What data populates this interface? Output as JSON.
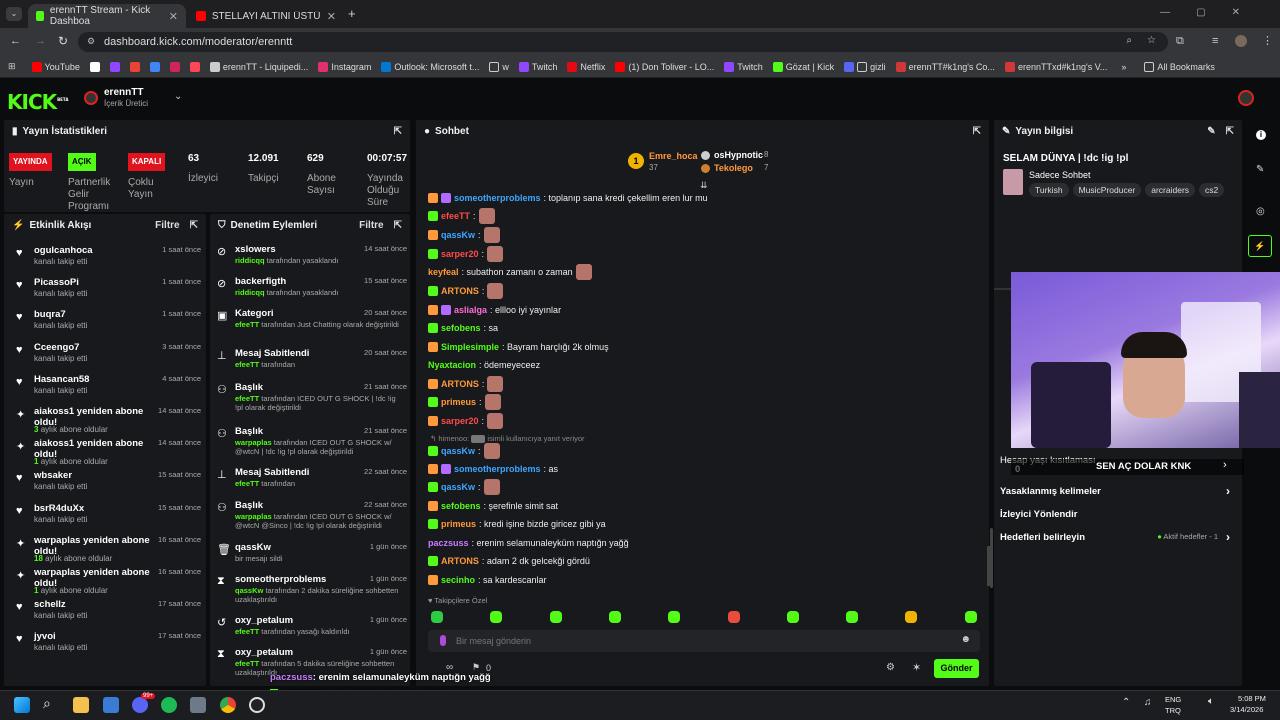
{
  "browser": {
    "tabs": [
      {
        "label": "erennTT Stream - Kick Dashboa"
      },
      {
        "label": "STELLAYI ALTINI ÜSTÜNE GETİR"
      }
    ],
    "url": "dashboard.kick.com/moderator/erenntt",
    "bookmarks": [
      "YouTube",
      "erennTT - Liquipedi...",
      "Instagram",
      "Outlook: Microsoft t...",
      "w",
      "Twitch",
      "Netflix",
      "(1) Don Toliver - LO...",
      "Twitch",
      "Gözat | Kick",
      "gizli",
      "erennTT#k1ng's Co...",
      "erennTTxd#k1ng's V..."
    ],
    "all_bookmarks": "All Bookmarks"
  },
  "header": {
    "logo": "KICK",
    "beta": "BETA",
    "user": "erennTT",
    "role": "İçerik Üretici"
  },
  "stats": {
    "title": "Yayın İstatistikleri",
    "yayin_badge": "YAYINDA",
    "yayin_label": "Yayın",
    "acik_badge": "AÇIK",
    "partner_label": "Partnerlik Gelir Programı",
    "kapali_badge": "KAPALI",
    "coklu_label": "Çoklu Yayın",
    "izleyici_val": "63",
    "izleyici_label": "İzleyici",
    "takipci_val": "12.091",
    "takipci_label": "Takipçi",
    "abone_val": "629",
    "abone_label": "Abone Sayısı",
    "sure_val": "00:07:57",
    "sure_label": "Yayında Olduğu Süre"
  },
  "activity": {
    "title": "Etkinlik Akışı",
    "filter": "Filtre",
    "items": [
      {
        "name": "ogulcanhoca",
        "sub": "kanalı takip etti",
        "time": "1 saat önce",
        "icon": "heart"
      },
      {
        "name": "PicassoPi",
        "sub": "kanalı takip etti",
        "time": "1 saat önce",
        "icon": "heart"
      },
      {
        "name": "buqra7",
        "sub": "kanalı takip etti",
        "time": "1 saat önce",
        "icon": "heart"
      },
      {
        "name": "Cceengo7",
        "sub": "kanalı takip etti",
        "time": "3 saat önce",
        "icon": "heart"
      },
      {
        "name": "Hasancan58",
        "sub": "kanalı takip etti",
        "time": "4 saat önce",
        "icon": "heart"
      },
      {
        "name": "aiakoss1 yeniden abone oldu!",
        "num": "3",
        "sub": "aylık abone oldular",
        "time": "14 saat önce",
        "icon": "star"
      },
      {
        "name": "aiakoss1 yeniden abone oldu!",
        "num": "1",
        "sub": "aylık abone oldular",
        "time": "14 saat önce",
        "icon": "star"
      },
      {
        "name": "wbsaker",
        "sub": "kanalı takip etti",
        "time": "15 saat önce",
        "icon": "heart"
      },
      {
        "name": "bsrR4duXx",
        "sub": "kanalı takip etti",
        "time": "15 saat önce",
        "icon": "heart"
      },
      {
        "name": "warpaplas yeniden abone oldu!",
        "num": "18",
        "sub": "aylık abone oldular",
        "time": "16 saat önce",
        "icon": "star"
      },
      {
        "name": "warpaplas yeniden abone oldu!",
        "num": "1",
        "sub": "aylık abone oldular",
        "time": "16 saat önce",
        "icon": "star"
      },
      {
        "name": "schellz",
        "sub": "kanalı takip etti",
        "time": "17 saat önce",
        "icon": "heart"
      },
      {
        "name": "jyvoi",
        "sub": "kanalı takip etti",
        "time": "17 saat önce",
        "icon": "heart"
      }
    ]
  },
  "moderation": {
    "title": "Denetim Eylemleri",
    "filter": "Filtre",
    "items": [
      {
        "name": "xslowers",
        "time": "14 saat önce",
        "actor": "riddicqq",
        "desc": " tarafından yasaklandı"
      },
      {
        "name": "backerfigth",
        "time": "15 saat önce",
        "actor": "riddicqq",
        "desc": " tarafından yasaklandı"
      },
      {
        "name": "Kategori",
        "time": "20 saat önce",
        "actor": "efeeTT",
        "desc": " tarafından Just Chatting olarak değiştirildi"
      },
      {
        "name": "Mesaj Sabitlendi",
        "time": "20 saat önce",
        "actor": "efeeTT",
        "desc": " tarafından"
      },
      {
        "name": "Başlık",
        "time": "21 saat önce",
        "actor": "efeeTT",
        "desc": " tarafından ICED OUT G SHOCK | !dc !ig !pl olarak değiştirildi"
      },
      {
        "name": "Başlık",
        "time": "21 saat önce",
        "actor": "warpaplas",
        "desc": " tarafından ICED OUT G SHOCK w/ @wtcN | !dc !ig !pl olarak değiştirildi"
      },
      {
        "name": "Mesaj Sabitlendi",
        "time": "22 saat önce",
        "actor": "efeeTT",
        "desc": " tarafından"
      },
      {
        "name": "Başlık",
        "time": "22 saat önce",
        "actor": "warpaplas",
        "desc": " tarafından ICED OUT G SHOCK w/ @wtcN @Sinco | !dc !ig !pl olarak değiştirildi"
      },
      {
        "name": "qassKw",
        "time": "1 gün önce",
        "actor": "",
        "desc": "bir mesajı sildi"
      },
      {
        "name": "someotherproblems",
        "time": "1 gün önce",
        "actor": "qassKw",
        "desc": " tarafından 2 dakika süreliğine sohbetten uzaklaştırıldı"
      },
      {
        "name": "oxy_petalum",
        "time": "1 gün önce",
        "actor": "efeeTT",
        "desc": " tarafından yasağı kaldırıldı"
      },
      {
        "name": "oxy_petalum",
        "time": "1 gün önce",
        "actor": "efeeTT",
        "desc": " tarafından 5 dakika süreliğine sohbetten uzaklaştırıldı"
      }
    ]
  },
  "chat": {
    "title": "Sohbet",
    "top1_name": "Emre_hoca",
    "top1_val": "37",
    "top2_name": "osHypnotic",
    "top2_val": "8",
    "top3_name": "Tekolego",
    "top3_val": "7",
    "messages": [
      {
        "user": "someotherproblems",
        "color": "#3ea7ff",
        "text": ": toplanıp sana kredi çekellim eren lur mu"
      },
      {
        "user": "efeeTT",
        "color": "#ff4b4b",
        "text": ":"
      },
      {
        "user": "qassKw",
        "color": "#3ea7ff",
        "text": ":"
      },
      {
        "user": "sarper20",
        "color": "#ff4b4b",
        "text": ":"
      },
      {
        "user": "keyfeal",
        "color": "#ff9a3c",
        "text": ": subathon zamanı o zaman"
      },
      {
        "user": "ARTONS",
        "color": "#ff9a3c",
        "text": ":"
      },
      {
        "user": "aslialga",
        "color": "#ff6bd6",
        "text": ": ellloo iyi yayınlar"
      },
      {
        "user": "sefobens",
        "color": "#53fc18",
        "text": ": sa"
      },
      {
        "user": "Simplesimple",
        "color": "#53fc18",
        "text": ": Bayram harçlığı 2k olmuş"
      },
      {
        "user": "Nyaxtacion",
        "color": "#53fc18",
        "text": ": ödemeyeceez"
      },
      {
        "user": "ARTONS",
        "color": "#ff9a3c",
        "text": ":"
      },
      {
        "user": "primeus",
        "color": "#ff9a3c",
        "text": ":"
      },
      {
        "user": "sarper20",
        "color": "#ff4b4b",
        "text": ":"
      },
      {
        "user": "qassKw",
        "color": "#3ea7ff",
        "text": ":"
      },
      {
        "user": "someotherproblems",
        "color": "#3ea7ff",
        "text": ": as"
      },
      {
        "user": "qassKw",
        "color": "#3ea7ff",
        "text": ":"
      },
      {
        "user": "sefobens",
        "color": "#53fc18",
        "text": ": şerefinle simit sat"
      },
      {
        "user": "primeus",
        "color": "#ff9a3c",
        "text": ": kredi işine bizde giricez gibi ya"
      },
      {
        "user": "paczsuss",
        "color": "#c77dff",
        "text": ": erenim selamunaleyküm naptığn yağğ"
      },
      {
        "user": "ARTONS",
        "color": "#ff9a3c",
        "text": ": adam 2 dk gelcekği gördü"
      },
      {
        "user": "secinho",
        "color": "#53fc18",
        "text": ": sa kardescanlar"
      }
    ],
    "reply_name": "himenoo:",
    "reply_text": "isimli kullanıcıya yanıt veriyor",
    "followers_only": "Takipçilere Özel",
    "placeholder": "Bir mesaj gönderin",
    "count": "0",
    "send": "Gönder"
  },
  "stream_info": {
    "title": "Yayın bilgisi",
    "stream_title": "SELAM DÜNYA | !dc !ig !pl",
    "category": "Sadece Sohbet",
    "tags": [
      "Turkish",
      "MusicProducer",
      "arcraiders",
      "cs2"
    ],
    "rows": [
      "Yasaklanmış kelimeler",
      "İzleyici Yönlendir",
      "Hedefleri belirleyin"
    ],
    "goal_status": "Aktif hedefler - 1",
    "age_label": "Hesap yaşı kısıtlaması",
    "overlay_text": "SEN AÇ DOLAR KNK",
    "overlay_num": "10",
    "overlay_left": "0"
  },
  "overlay_chat": [
    {
      "user": "paczsuss",
      "text": ": erenim selamunaleyküm naptığn yağğ"
    },
    {
      "user": "ARTONS",
      "text": ": adam 2 dk gelcekği gördü"
    },
    {
      "user": "secinho",
      "text": ": sa kardescanlar"
    }
  ],
  "taskbar": {
    "lang1": "ENG",
    "lang2": "TRQ",
    "time": "5:08 PM",
    "date": "3/14/2026",
    "badge": "99+"
  }
}
